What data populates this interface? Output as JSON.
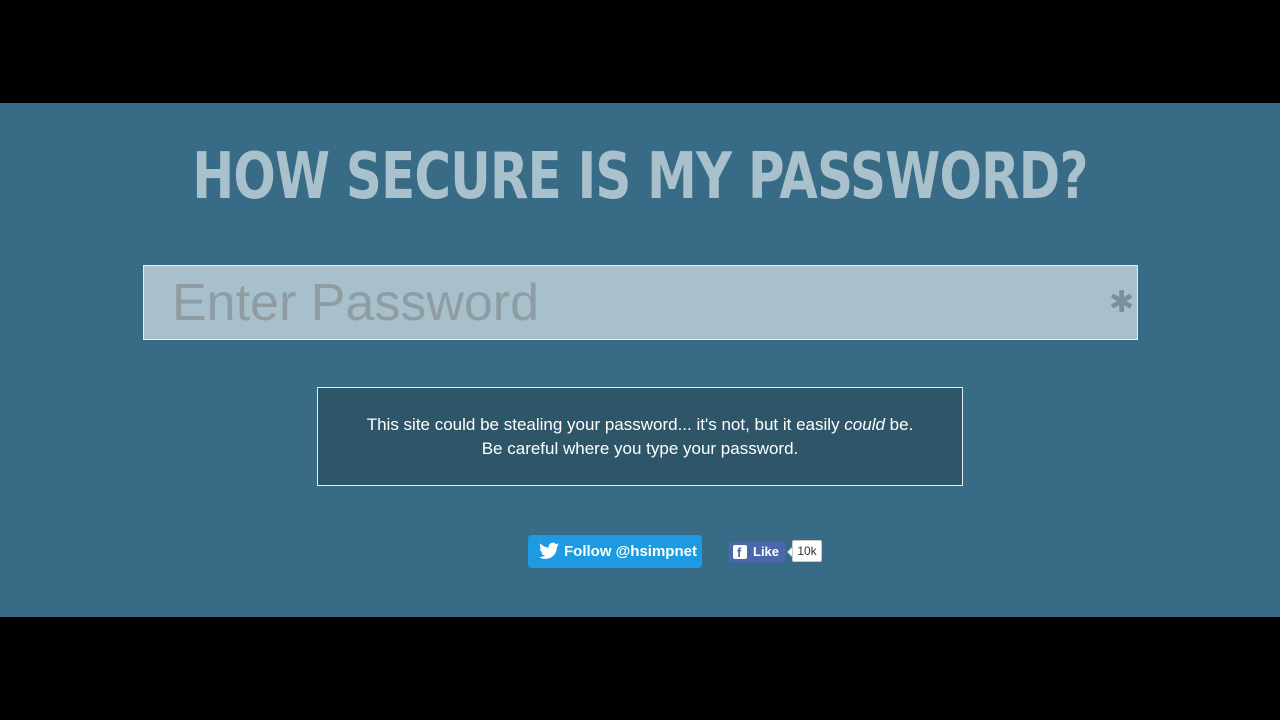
{
  "page": {
    "title": "HOW SECURE IS MY PASSWORD?"
  },
  "password_field": {
    "placeholder": "Enter Password",
    "value": "",
    "toggle_icon": "asterisk-icon"
  },
  "notice": {
    "line1_before": "This site could be stealing your password... it's not, but it easily ",
    "line1_emphasis": "could",
    "line1_after": " be.",
    "line2": "Be careful where you type your password."
  },
  "social": {
    "twitter": {
      "icon": "twitter-bird-icon",
      "label": "Follow @hsimpnet"
    },
    "facebook": {
      "icon": "facebook-icon",
      "icon_glyph": "f",
      "label": "Like",
      "count": "10k"
    }
  },
  "colors": {
    "background": "#386b85",
    "letterbox": "#000000",
    "title": "#a9c1cc",
    "input_background": "#a8c0cb",
    "notice_background": "#2e5568",
    "twitter": "#1d9be2",
    "facebook": "#4a67ad"
  }
}
